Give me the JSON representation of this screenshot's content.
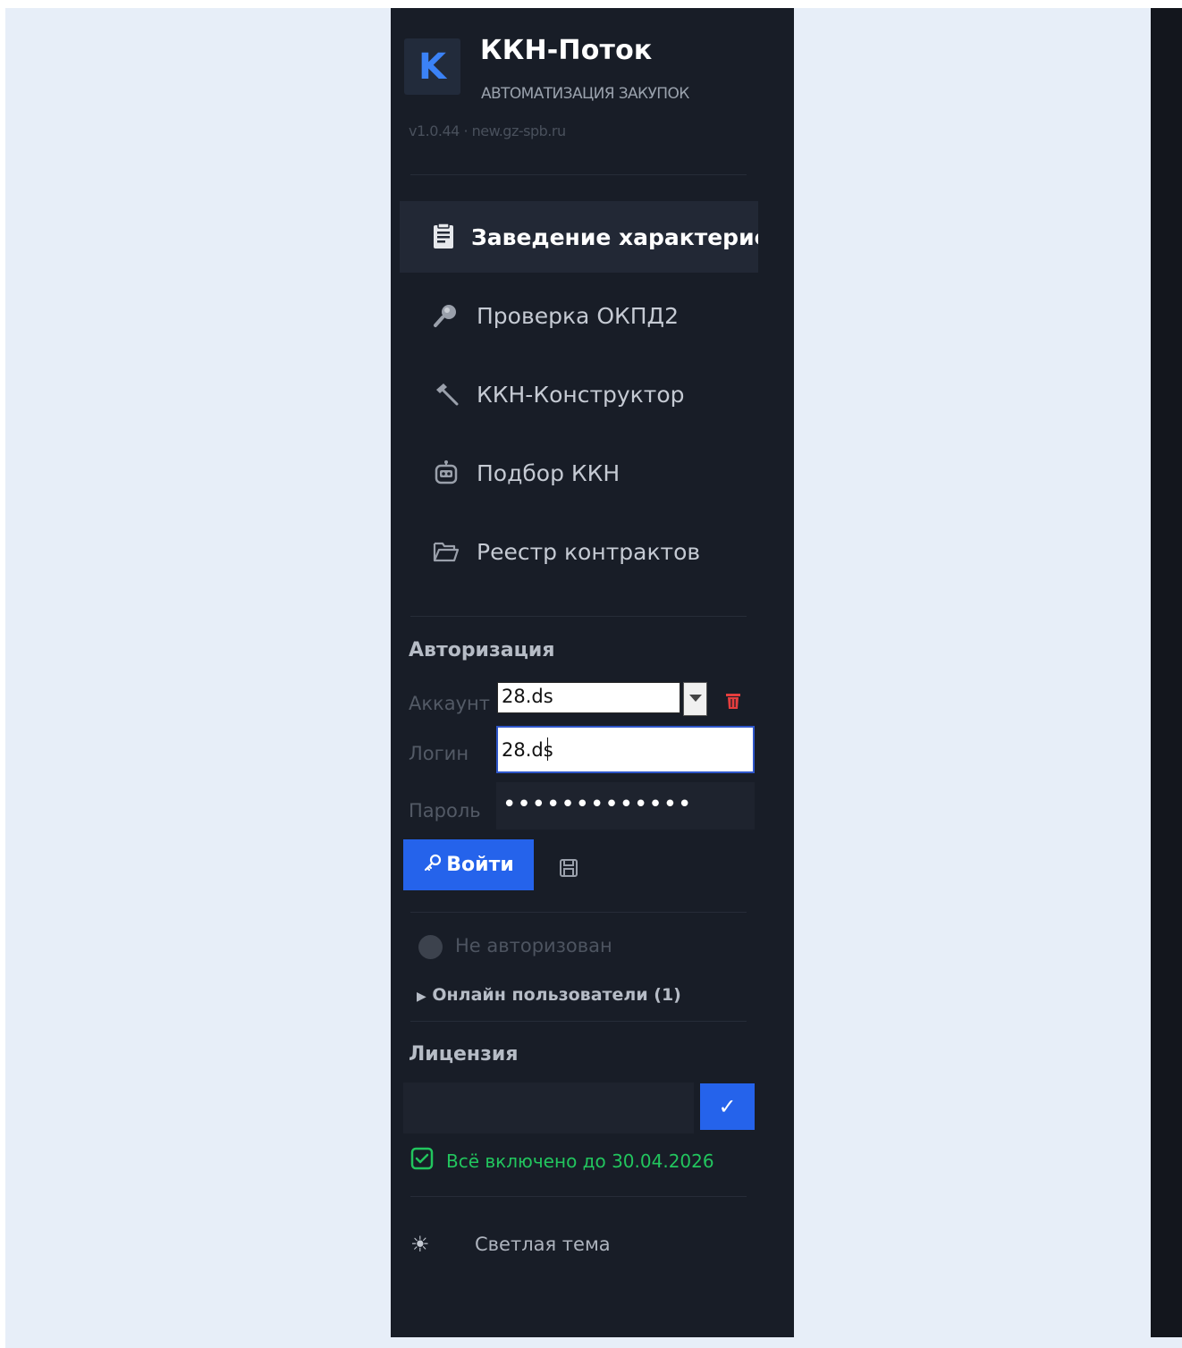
{
  "header": {
    "logo_letter": "K",
    "title": "ККН-Поток",
    "subtitle": "АВТОМАТИЗАЦИЯ ЗАКУПОК",
    "version": "v1.0.44 · new.gz-spb.ru"
  },
  "nav": {
    "items": [
      {
        "label": "Заведение характеристи",
        "icon": "clipboard-icon",
        "active": true
      },
      {
        "label": "Проверка ОКПД2",
        "icon": "magnifier-icon"
      },
      {
        "label": "ККН-Конструктор",
        "icon": "hammer-icon"
      },
      {
        "label": "Подбор ККН",
        "icon": "robot-icon"
      },
      {
        "label": "Реестр контрактов",
        "icon": "folder-icon"
      }
    ]
  },
  "auth": {
    "title": "Авторизация",
    "account_label": "Аккаунт",
    "account_value": "28.ds",
    "login_label": "Логин",
    "login_value": "28.ds",
    "password_label": "Пароль",
    "password_value": "•••••••••••••",
    "login_button": "Войти",
    "status": "Не авторизован",
    "online_users": "Онлайн пользователи (1)"
  },
  "license": {
    "title": "Лицензия",
    "key_value": "",
    "confirm_symbol": "✓",
    "status": "Всё включено до 30.04.2026"
  },
  "theme": {
    "label": "Светлая тема",
    "icon": "sun-icon"
  },
  "colors": {
    "sidebar_bg": "#181d27",
    "accent": "#2563eb",
    "logo_accent": "#3b82f6",
    "success": "#22c55e",
    "danger": "#e53e3e"
  }
}
